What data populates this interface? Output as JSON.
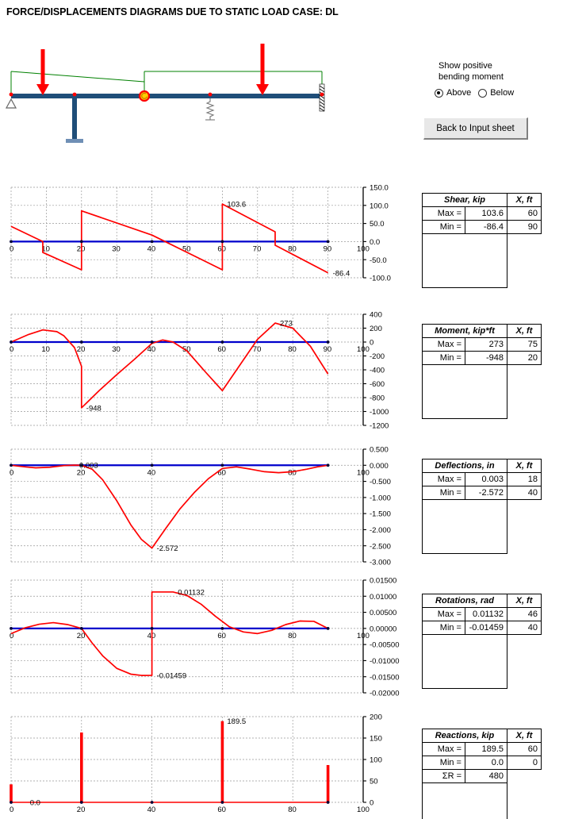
{
  "page": {
    "title": "FORCE/DISPLACEMENTS DIAGRAMS DUE TO STATIC LOAD CASE: DL"
  },
  "controls": {
    "caption_line1": "Show positive",
    "caption_line2": "bending moment",
    "radio_above": "Above",
    "radio_below": "Below",
    "selected": "Above",
    "back_button": "Back to Input  sheet"
  },
  "beam_model": {
    "span_start_ft": 0,
    "span_end_ft": 90,
    "supports": [
      {
        "type": "pin",
        "x_ft": 0
      },
      {
        "type": "column",
        "x_ft": 20
      },
      {
        "type": "spring",
        "x_ft": 57
      },
      {
        "type": "fixed",
        "x_ft": 90
      }
    ],
    "hinge": {
      "x_ft": 40
    },
    "point_loads": [
      {
        "x_ft": 12
      },
      {
        "x_ft": 74
      }
    ],
    "distributed_loads": [
      {
        "from_ft": 0,
        "to_ft": 40,
        "shape": "trapezoid"
      },
      {
        "from_ft": 40,
        "to_ft": 90,
        "shape": "uniform"
      }
    ]
  },
  "tables": [
    {
      "name": "shear",
      "header_left": "Shear, kip",
      "header_right": "X, ft",
      "rows": [
        {
          "label": "Max =",
          "value": "103.6",
          "x": "60"
        },
        {
          "label": "Min =",
          "value": "-86.4",
          "x": "90"
        }
      ]
    },
    {
      "name": "moment",
      "header_left": "Moment, kip*ft",
      "header_right": "X, ft",
      "rows": [
        {
          "label": "Max =",
          "value": "273",
          "x": "75"
        },
        {
          "label": "Min =",
          "value": "-948",
          "x": "20"
        }
      ]
    },
    {
      "name": "deflections",
      "header_left": "Deflections, in",
      "header_right": "X, ft",
      "rows": [
        {
          "label": "Max =",
          "value": "0.003",
          "x": "18"
        },
        {
          "label": "Min =",
          "value": "-2.572",
          "x": "40"
        }
      ]
    },
    {
      "name": "rotations",
      "header_left": "Rotations, rad",
      "header_right": "X, ft",
      "rows": [
        {
          "label": "Max =",
          "value": "0.01132",
          "x": "46"
        },
        {
          "label": "Min =",
          "value": "-0.01459",
          "x": "40"
        }
      ]
    },
    {
      "name": "reactions",
      "header_left": "Reactions, kip",
      "header_right": "X, ft",
      "rows": [
        {
          "label": "Max =",
          "value": "189.5",
          "x": "60"
        },
        {
          "label": "Min =",
          "value": "0.0",
          "x": "0"
        },
        {
          "label": "ΣR =",
          "value": "480",
          "x": ""
        }
      ]
    }
  ],
  "colors": {
    "curve": "#ff0000",
    "baseline": "#0000cc",
    "beam": "#1f4e79",
    "load": "#ff0000",
    "dist_load": "#008000",
    "grid": "#999999",
    "axis": "#000000"
  },
  "chart_data": [
    {
      "type": "line",
      "name": "shear",
      "title": "Shear, kip",
      "xlabel": "X, ft",
      "ylabel": "Shear, kip",
      "xlim": [
        0,
        100
      ],
      "ylim": [
        -100,
        150
      ],
      "xticks": [
        0,
        10,
        20,
        30,
        40,
        50,
        60,
        70,
        80,
        90,
        100
      ],
      "yticks": [
        150.0,
        100.0,
        50.0,
        0.0,
        -50.0,
        -100.0
      ],
      "ytick_labels": [
        "150.0",
        "100.0",
        "50.0",
        "0.0",
        "-50.0",
        "-100.0"
      ],
      "grid": true,
      "annotations": [
        {
          "text": "103.6",
          "x": 60,
          "y": 103.6
        },
        {
          "text": "-86.4",
          "x": 90,
          "y": -86.4
        }
      ],
      "node_markers_x": [
        0,
        20,
        40,
        60,
        90
      ],
      "x": [
        0,
        9,
        9,
        20,
        20,
        40,
        60,
        60,
        75,
        75,
        90
      ],
      "y": [
        42,
        0,
        -30,
        -78,
        85,
        18,
        -78,
        103.6,
        27,
        -10,
        -86.4
      ]
    },
    {
      "type": "line",
      "name": "moment",
      "title": "Moment, kip*ft",
      "xlabel": "X, ft",
      "ylabel": "Moment, kip*ft",
      "xlim": [
        0,
        100
      ],
      "ylim": [
        -1200,
        400
      ],
      "xticks": [
        0,
        10,
        20,
        30,
        40,
        50,
        60,
        70,
        80,
        90,
        100
      ],
      "yticks": [
        400,
        200,
        0,
        -200,
        -400,
        -600,
        -800,
        -1000,
        -1200
      ],
      "ytick_labels": [
        "400",
        "200",
        "0",
        "-200",
        "-400",
        "-600",
        "-800",
        "-1000",
        "-1200"
      ],
      "grid": true,
      "annotations": [
        {
          "text": "273",
          "x": 75,
          "y": 273
        },
        {
          "text": "-948",
          "x": 20,
          "y": -948
        }
      ],
      "node_markers_x": [
        0,
        20,
        40,
        60,
        90
      ],
      "x": [
        0,
        5,
        9,
        13,
        15,
        18,
        20,
        20,
        25,
        30,
        35,
        40,
        43,
        46,
        50,
        55,
        60,
        65,
        70,
        75,
        80,
        85,
        90
      ],
      "y": [
        0,
        110,
        175,
        150,
        90,
        -80,
        -350,
        -948,
        -700,
        -470,
        -250,
        -20,
        30,
        0,
        -130,
        -420,
        -700,
        -330,
        40,
        273,
        200,
        -60,
        -460
      ]
    },
    {
      "type": "line",
      "name": "deflections",
      "title": "Deflections, in",
      "xlabel": "X, ft",
      "ylabel": "Deflections, in",
      "xlim": [
        0,
        100
      ],
      "ylim": [
        -3.0,
        0.5
      ],
      "xticks": [
        0,
        20,
        40,
        60,
        80,
        100
      ],
      "yticks": [
        0.5,
        0.0,
        -0.5,
        -1.0,
        -1.5,
        -2.0,
        -2.5,
        -3.0
      ],
      "ytick_labels": [
        "0.500",
        "0.000",
        "-0.500",
        "-1.000",
        "-1.500",
        "-2.000",
        "-2.500",
        "-3.000"
      ],
      "grid": true,
      "annotations": [
        {
          "text": "0.003",
          "x": 18,
          "y": 0.003
        },
        {
          "text": "-2.572",
          "x": 40,
          "y": -2.572
        }
      ],
      "node_markers_x": [
        0,
        20,
        40,
        60,
        90
      ],
      "x": [
        0,
        4,
        7,
        11,
        15,
        18,
        20,
        23,
        26,
        30,
        34,
        37,
        40,
        44,
        48,
        52,
        56,
        60,
        64,
        68,
        72,
        76,
        80,
        84,
        87,
        90
      ],
      "y": [
        0,
        -0.05,
        -0.08,
        -0.06,
        -0.01,
        0.003,
        0.0,
        -0.12,
        -0.45,
        -1.1,
        -1.85,
        -2.3,
        -2.572,
        -1.95,
        -1.35,
        -0.85,
        -0.42,
        -0.1,
        -0.05,
        -0.12,
        -0.2,
        -0.23,
        -0.2,
        -0.12,
        -0.05,
        0.0
      ]
    },
    {
      "type": "line",
      "name": "rotations",
      "title": "Rotations, rad",
      "xlabel": "X, ft",
      "ylabel": "Rotations, rad",
      "xlim": [
        0,
        100
      ],
      "ylim": [
        -0.02,
        0.015
      ],
      "xticks": [
        0,
        20,
        40,
        60,
        80,
        100
      ],
      "yticks": [
        0.015,
        0.01,
        0.005,
        0.0,
        -0.005,
        -0.01,
        -0.015,
        -0.02
      ],
      "ytick_labels": [
        "0.01500",
        "0.01000",
        "0.00500",
        "0.00000",
        "-0.00500",
        "-0.01000",
        "-0.01500",
        "-0.02000"
      ],
      "grid": true,
      "annotations": [
        {
          "text": "0.01132",
          "x": 46,
          "y": 0.01132
        },
        {
          "text": "-0.01459",
          "x": 40,
          "y": -0.01459
        }
      ],
      "node_markers_x": [
        0,
        20,
        40,
        60,
        90
      ],
      "x": [
        0,
        4,
        8,
        12,
        16,
        20,
        23,
        26,
        30,
        34,
        37,
        40,
        40,
        46,
        50,
        54,
        58,
        62,
        66,
        70,
        74,
        78,
        82,
        86,
        90
      ],
      "y": [
        -0.0016,
        0.0002,
        0.0013,
        0.0018,
        0.0012,
        0.0,
        -0.0045,
        -0.0085,
        -0.0124,
        -0.0142,
        -0.0146,
        -0.01459,
        0.01132,
        0.01132,
        0.0102,
        0.0075,
        0.0038,
        0.0005,
        -0.0011,
        -0.0016,
        -0.0006,
        0.0012,
        0.0023,
        0.0022,
        0.0
      ]
    },
    {
      "type": "bar",
      "name": "reactions",
      "title": "Reactions, kip",
      "xlabel": "X, ft",
      "ylabel": "Reactions, kip",
      "xlim": [
        0,
        100
      ],
      "ylim": [
        0,
        200
      ],
      "xticks": [
        0,
        20,
        40,
        60,
        80,
        100
      ],
      "yticks": [
        200,
        150,
        100,
        50,
        0
      ],
      "ytick_labels": [
        "200",
        "150",
        "100",
        "50",
        "0"
      ],
      "grid": true,
      "annotations": [
        {
          "text": "189.5",
          "x": 60,
          "y": 189.5
        },
        {
          "text": "0.0",
          "x": 4,
          "y": 0
        }
      ],
      "node_markers_x": [
        0,
        20,
        40,
        60,
        90
      ],
      "categories": [
        0,
        20,
        40,
        60,
        90
      ],
      "values": [
        42,
        163,
        0,
        189.5,
        87
      ]
    }
  ]
}
